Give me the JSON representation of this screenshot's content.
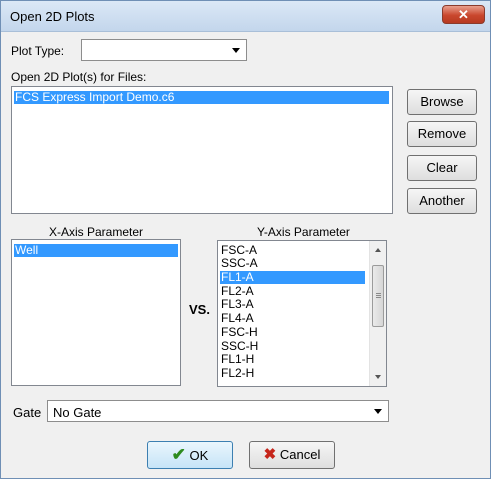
{
  "window": {
    "title": "Open 2D Plots",
    "close_glyph": "✕"
  },
  "plot_type": {
    "label": "Plot Type:",
    "value": ""
  },
  "files": {
    "label": "Open 2D Plot(s) for Files:",
    "items": [
      "FCS Express Import Demo.c6"
    ],
    "selected_index": 0
  },
  "side_buttons": {
    "browse": "Browse",
    "remove": "Remove",
    "clear": "Clear",
    "another": "Another"
  },
  "x_axis": {
    "header": "X-Axis Parameter",
    "items": [
      "Well"
    ],
    "selected_index": 0
  },
  "vs_label": "VS.",
  "y_axis": {
    "header": "Y-Axis Parameter",
    "items": [
      "FSC-A",
      "SSC-A",
      "FL1-A",
      "FL2-A",
      "FL3-A",
      "FL4-A",
      "FSC-H",
      "SSC-H",
      "FL1-H",
      "FL2-H"
    ],
    "selected_index": 2
  },
  "gate": {
    "label": "Gate",
    "value": "No Gate"
  },
  "footer": {
    "ok_label": "OK",
    "ok_icon": "check-icon",
    "cancel_label": "Cancel",
    "cancel_icon": "x-icon"
  },
  "colors": {
    "selection": "#3399ff",
    "title_bar": "#c3d6ec",
    "close_button": "#c9472d"
  }
}
